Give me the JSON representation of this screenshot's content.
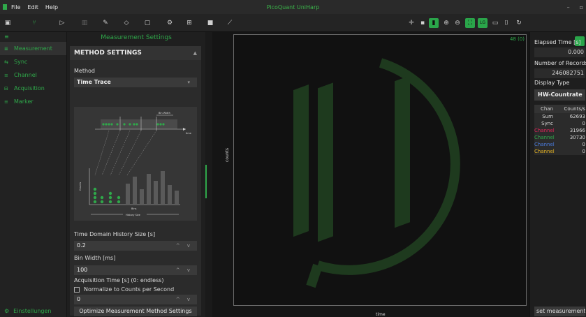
{
  "app": {
    "title": "PicoQuant UniHarp",
    "menu": [
      "File",
      "Edit",
      "Help"
    ],
    "window_controls": [
      "–",
      "▫"
    ]
  },
  "toolbar_icons": [
    "dashboard-icon",
    "branch-icon",
    "play-icon",
    "stop-icon",
    "pen-icon",
    "eraser-icon",
    "comment-icon",
    "gear-icon",
    "sliders-icon",
    "save-icon",
    "link-icon",
    "crosshair-icon",
    "square-icon",
    "plot-icon",
    "zoom-in-icon",
    "zoom-out-icon",
    "fit-icon",
    "log-icon",
    "rect-icon",
    "bracket-icon",
    "refresh-icon"
  ],
  "sidebar": {
    "top": "≡",
    "items": [
      {
        "icon": "≣",
        "label": "Measurement",
        "active": true
      },
      {
        "icon": "⇆",
        "label": "Sync",
        "active": false
      },
      {
        "icon": "≡",
        "label": "Channel",
        "active": false
      },
      {
        "icon": "⊟",
        "label": "Acquisition",
        "active": false
      },
      {
        "icon": "≡",
        "label": "Marker",
        "active": false
      }
    ],
    "settings": {
      "icon": "⚙",
      "label": "Einstellungen"
    }
  },
  "settings_panel": {
    "title": "Measurement Settings",
    "section_title": "METHOD SETTINGS",
    "method_label": "Method",
    "method_value": "Time Trace",
    "history_label": "Time Domain History Size [s]",
    "history_value": "0.2",
    "bin_width_label": "Bin Width [ms]",
    "bin_width_value": "100",
    "normalize_label": "Normalize to Counts per Second",
    "acq_time_label": "Acquisition Time [s] (0: endless)",
    "acq_time_value": "0",
    "optimize_button": "Optimize Measurement Method Settings",
    "diagram": {
      "bin_width_text": "Bin Width",
      "time_text": "time",
      "counts_text": "Counts",
      "bins_text": "Bins",
      "history_size_text": "History Size"
    }
  },
  "plot": {
    "fps": "48 (0)",
    "y_label": "counts",
    "x_label": "time"
  },
  "right_panel": {
    "elapsed_label": "Elapsed Time [s]",
    "elapsed_value": "0.000",
    "records_label": "Number of Records",
    "records_value": "246082751",
    "display_type_label": "Display Type",
    "display_type_value": "HW-Countrate",
    "table_header": [
      "Chan",
      "Counts/s"
    ],
    "rows": [
      {
        "chan": "Sum",
        "value": "62693",
        "color": "#e0e0e0"
      },
      {
        "chan": "Sync",
        "value": "0",
        "color": "#e0e0e0"
      },
      {
        "chan": "Channel",
        "value": "31966",
        "color": "#e0245a"
      },
      {
        "chan": "Channel",
        "value": "30730",
        "color": "#2fa84a"
      },
      {
        "chan": "Channel",
        "value": "0",
        "color": "#4a7bdc"
      },
      {
        "chan": "Channel",
        "value": "0",
        "color": "#e6b422"
      }
    ],
    "set_button": "set measurement"
  }
}
